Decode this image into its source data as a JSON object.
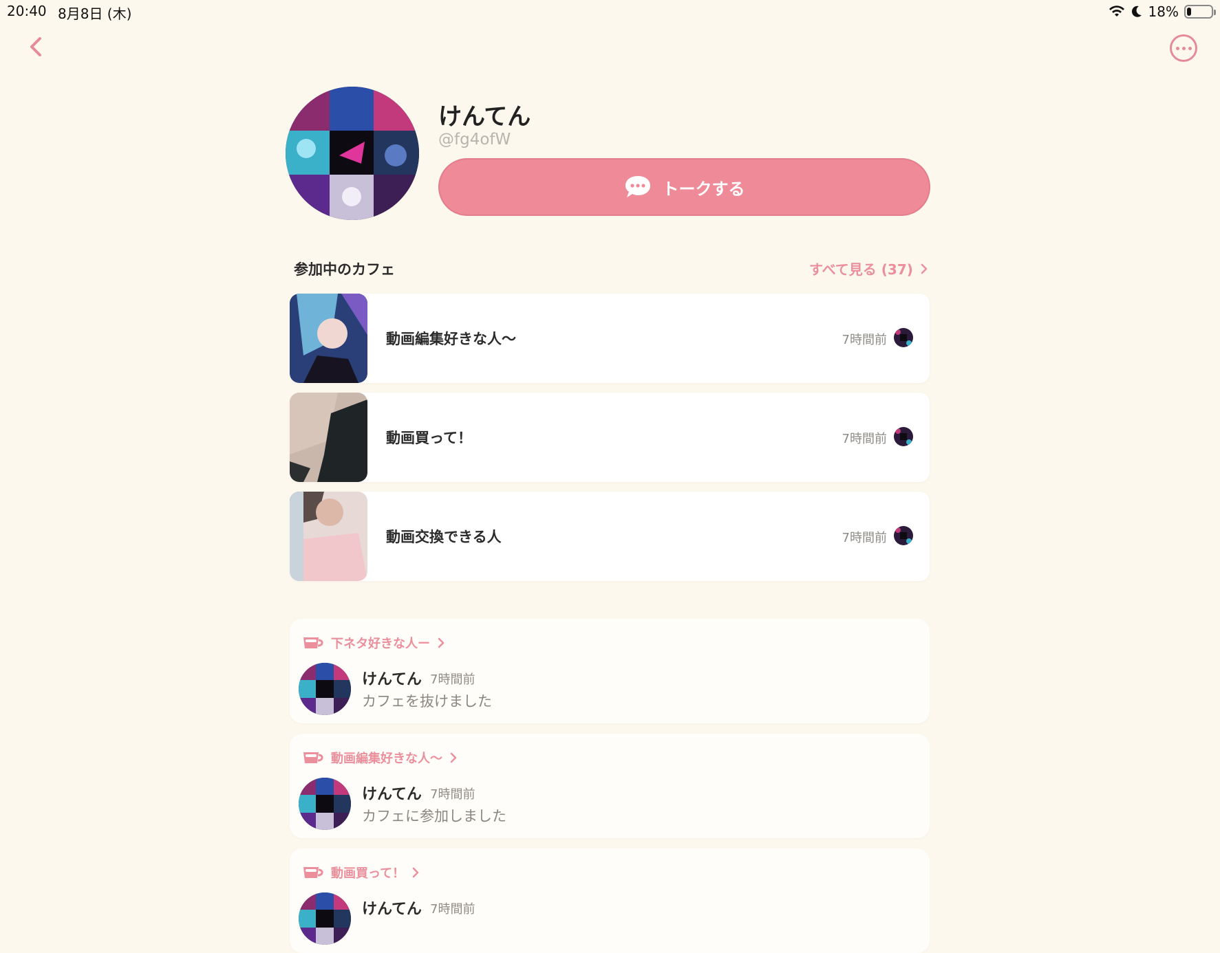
{
  "status_bar": {
    "time": "20:40",
    "date": "8月8日 (木)",
    "battery_percent": "18%",
    "battery_level": 0.18
  },
  "nav": {
    "back_icon": "chevron-left-icon",
    "more_icon": "ellipsis-circle-icon"
  },
  "profile": {
    "name": "けんてん",
    "handle": "@fg4ofW",
    "talk_button_label": "トークする"
  },
  "cafes_section": {
    "title": "参加中のカフェ",
    "see_all_label": "すべて見る (37)",
    "items": [
      {
        "name": "動画編集好きな人〜",
        "time": "7時間前"
      },
      {
        "name": "動画買って！",
        "time": "7時間前"
      },
      {
        "name": "動画交換できる人",
        "time": "7時間前"
      }
    ]
  },
  "activity": [
    {
      "cafe": "下ネタ好きな人ー",
      "user": "けんてん",
      "time": "7時間前",
      "text": "カフェを抜けました"
    },
    {
      "cafe": "動画編集好きな人〜",
      "user": "けんてん",
      "time": "7時間前",
      "text": "カフェに参加しました"
    },
    {
      "cafe": "動画買って！",
      "user": "けんてん",
      "time": "7時間前",
      "text": ""
    }
  ],
  "colors": {
    "background": "#fdf8ee",
    "accent": "#ef8b98",
    "accent_text": "#ea8f9b"
  }
}
